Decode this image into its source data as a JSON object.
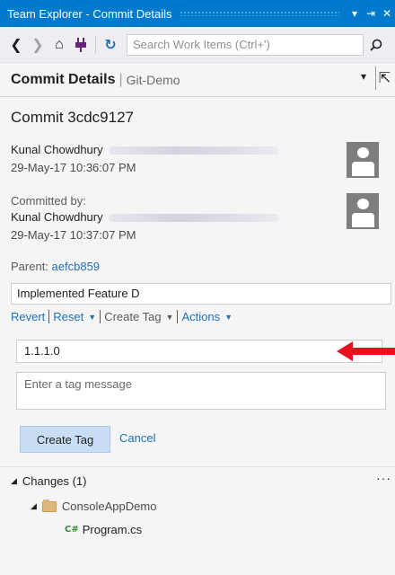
{
  "window": {
    "title": "Team Explorer - Commit Details",
    "title_buttons": [
      "▾",
      "⇥",
      "✕"
    ]
  },
  "toolbar": {
    "back": "❮",
    "forward": "❯",
    "home": "⌂",
    "connect": "⚲",
    "refresh": "↻",
    "search_placeholder": "Search Work Items (Ctrl+')",
    "search_icon": "⚲"
  },
  "header": {
    "page_title": "Commit Details",
    "divider": "|",
    "repo": "Git-Demo",
    "dropdown": "▾",
    "pin": "⇱"
  },
  "commit": {
    "title": "Commit 3cdc9127",
    "author": "Kunal Chowdhury",
    "author_date": "29-May-17 10:36:07 PM",
    "committed_by_label": "Committed by:",
    "committer": "Kunal Chowdhury",
    "commit_date": "29-May-17 10:37:07 PM",
    "parent_label": "Parent:",
    "parent_hash": "aefcb859",
    "message": "Implemented Feature D"
  },
  "actions": {
    "revert": "Revert",
    "reset": "Reset",
    "create_tag": "Create Tag",
    "actions": "Actions",
    "caret": "▼"
  },
  "tag_form": {
    "tag_value": "1.1.1.0",
    "message_placeholder": "Enter a tag message",
    "create_button": "Create Tag",
    "cancel": "Cancel"
  },
  "changes": {
    "header": "Changes (1)",
    "more": "···",
    "expand": "◢",
    "project": "ConsoleAppDemo",
    "file_icon": "C#",
    "file": "Program.cs"
  },
  "colors": {
    "accent": "#007acc",
    "link": "#1e6fb9",
    "arrow": "#e8111d"
  }
}
